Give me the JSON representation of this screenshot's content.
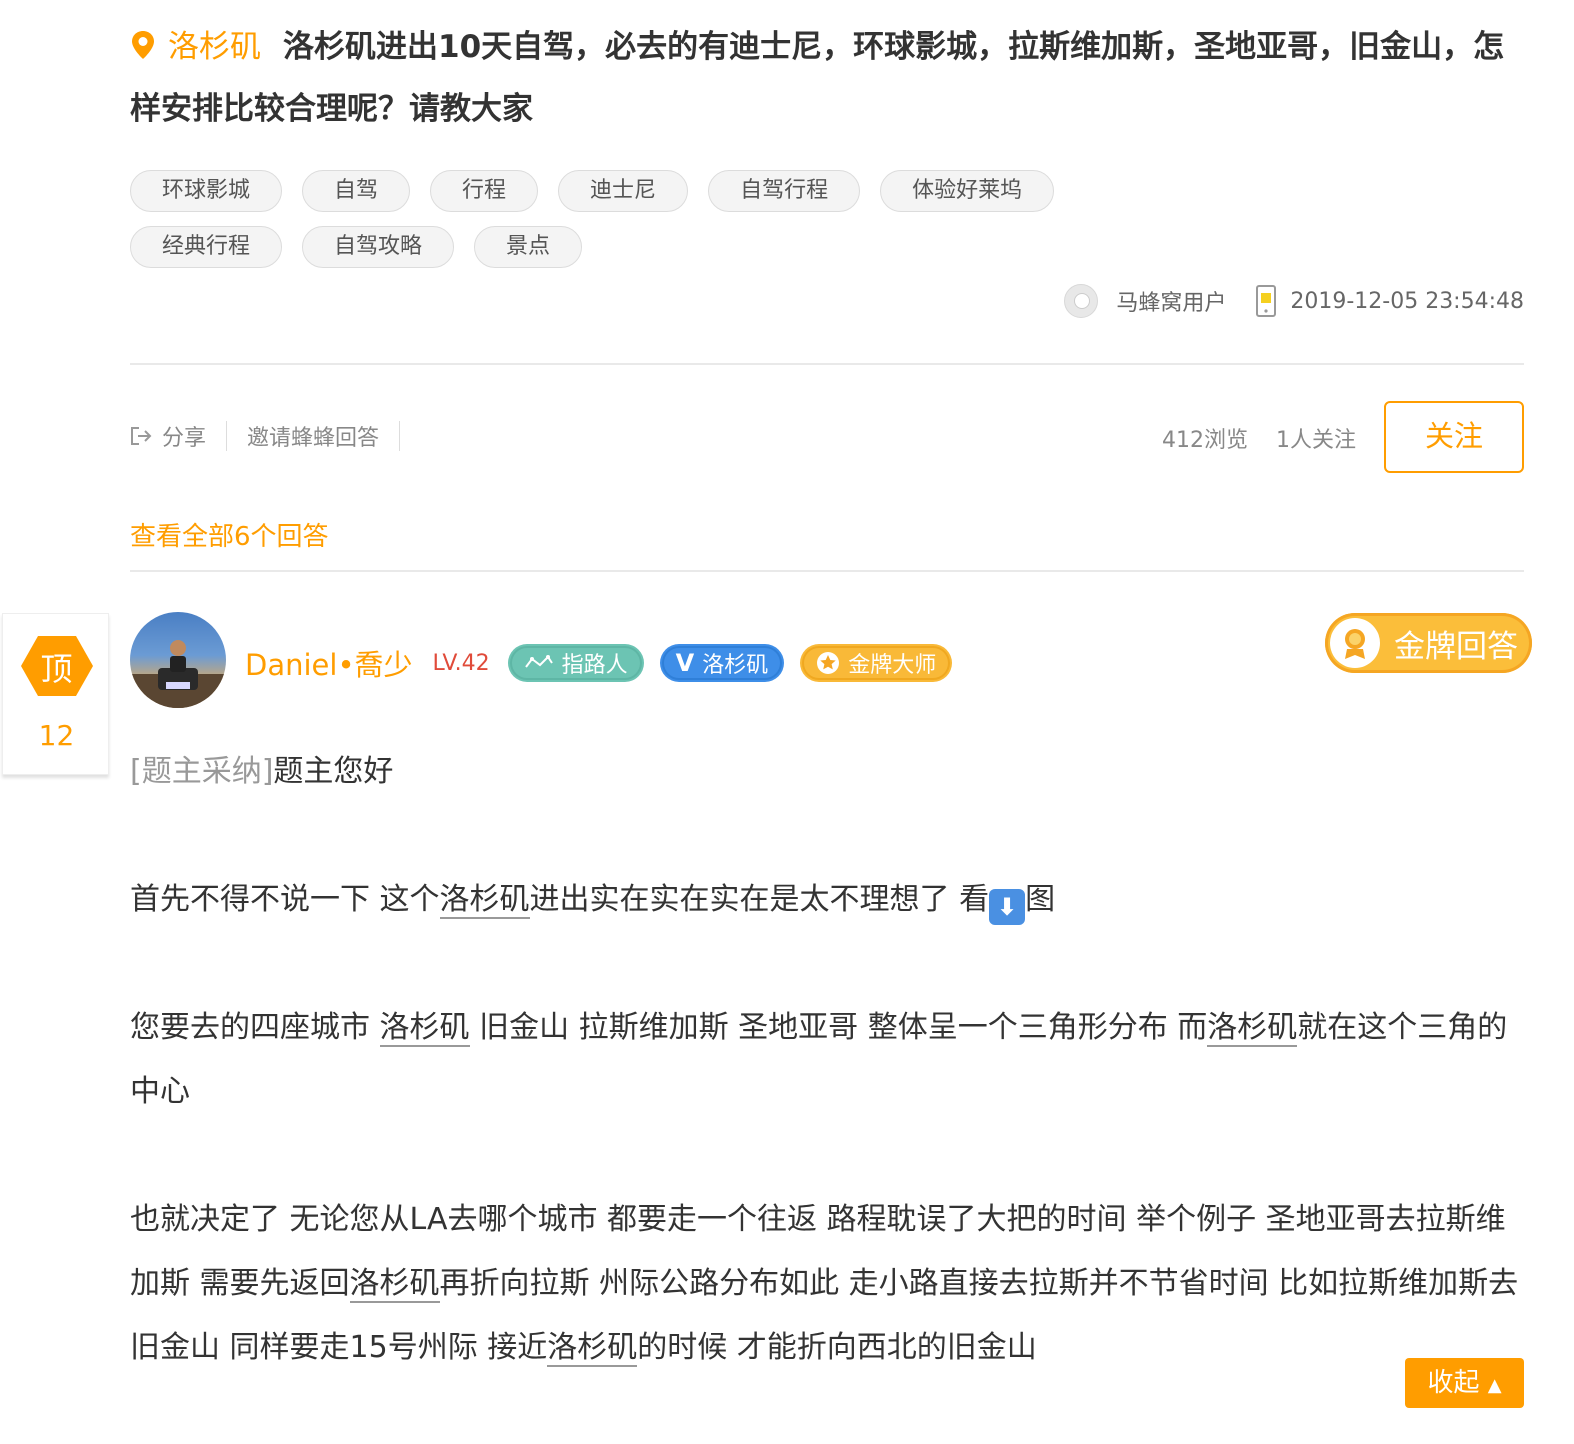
{
  "question": {
    "location": "洛杉矶",
    "title": "洛杉矶进出10天自驾，必去的有迪士尼，环球影城，拉斯维加斯，圣地亚哥，旧金山，怎样安排比较合理呢？请教大家",
    "tags": [
      "环球影城",
      "自驾",
      "行程",
      "迪士尼",
      "自驾行程",
      "体验好莱坞",
      "经典行程",
      "自驾攻略",
      "景点"
    ],
    "author": "马蜂窝用户",
    "datetime": "2019-12-05 23:54:48"
  },
  "actions": {
    "share": "分享",
    "invite": "邀请蜂蜂回答",
    "views": "412浏览",
    "followers": "1人关注",
    "follow_button": "关注"
  },
  "view_all": "查看全部6个回答",
  "vote": {
    "label": "顶",
    "count": "12"
  },
  "answer": {
    "user": "Daniel•喬少",
    "level": "LV.42",
    "badges": {
      "guide": "指路人",
      "v": "洛杉矶",
      "gold": "金牌大师"
    },
    "gold_answer": "金牌回答",
    "adopted": "[题主采纳]",
    "paragraphs": {
      "p1": "题主您好",
      "p2_a": "首先不得不说一下 这个",
      "p2_link": "洛杉矶",
      "p2_b": "进出实在实在实在是太不理想了 看",
      "p2_c": "图",
      "p3_a": "您要去的四座城市 ",
      "p3_link1": "洛杉矶",
      "p3_b": " 旧金山 拉斯维加斯 圣地亚哥 整体呈一个三角形分布 而",
      "p3_link2": "洛杉矶",
      "p3_c": "就在这个三角的中心",
      "p4_a": "也就决定了 无论您从LA去哪个城市 都要走一个往返 路程耽误了大把的时间 举个例子 圣地亚哥去拉斯维加斯 需要先返回",
      "p4_link1": "洛杉矶",
      "p4_b": "再折向拉斯 州际公路分布如此 走小路直接去拉斯并不节省时间 比如拉斯维加斯去旧金山 同样要走15号州际 接近",
      "p4_link2": "洛杉矶",
      "p4_c": "的时候 才能折向西北的旧金山"
    },
    "collapse": "收起"
  },
  "colors": {
    "accent": "#ff9d00",
    "level": "#e04b3a"
  }
}
